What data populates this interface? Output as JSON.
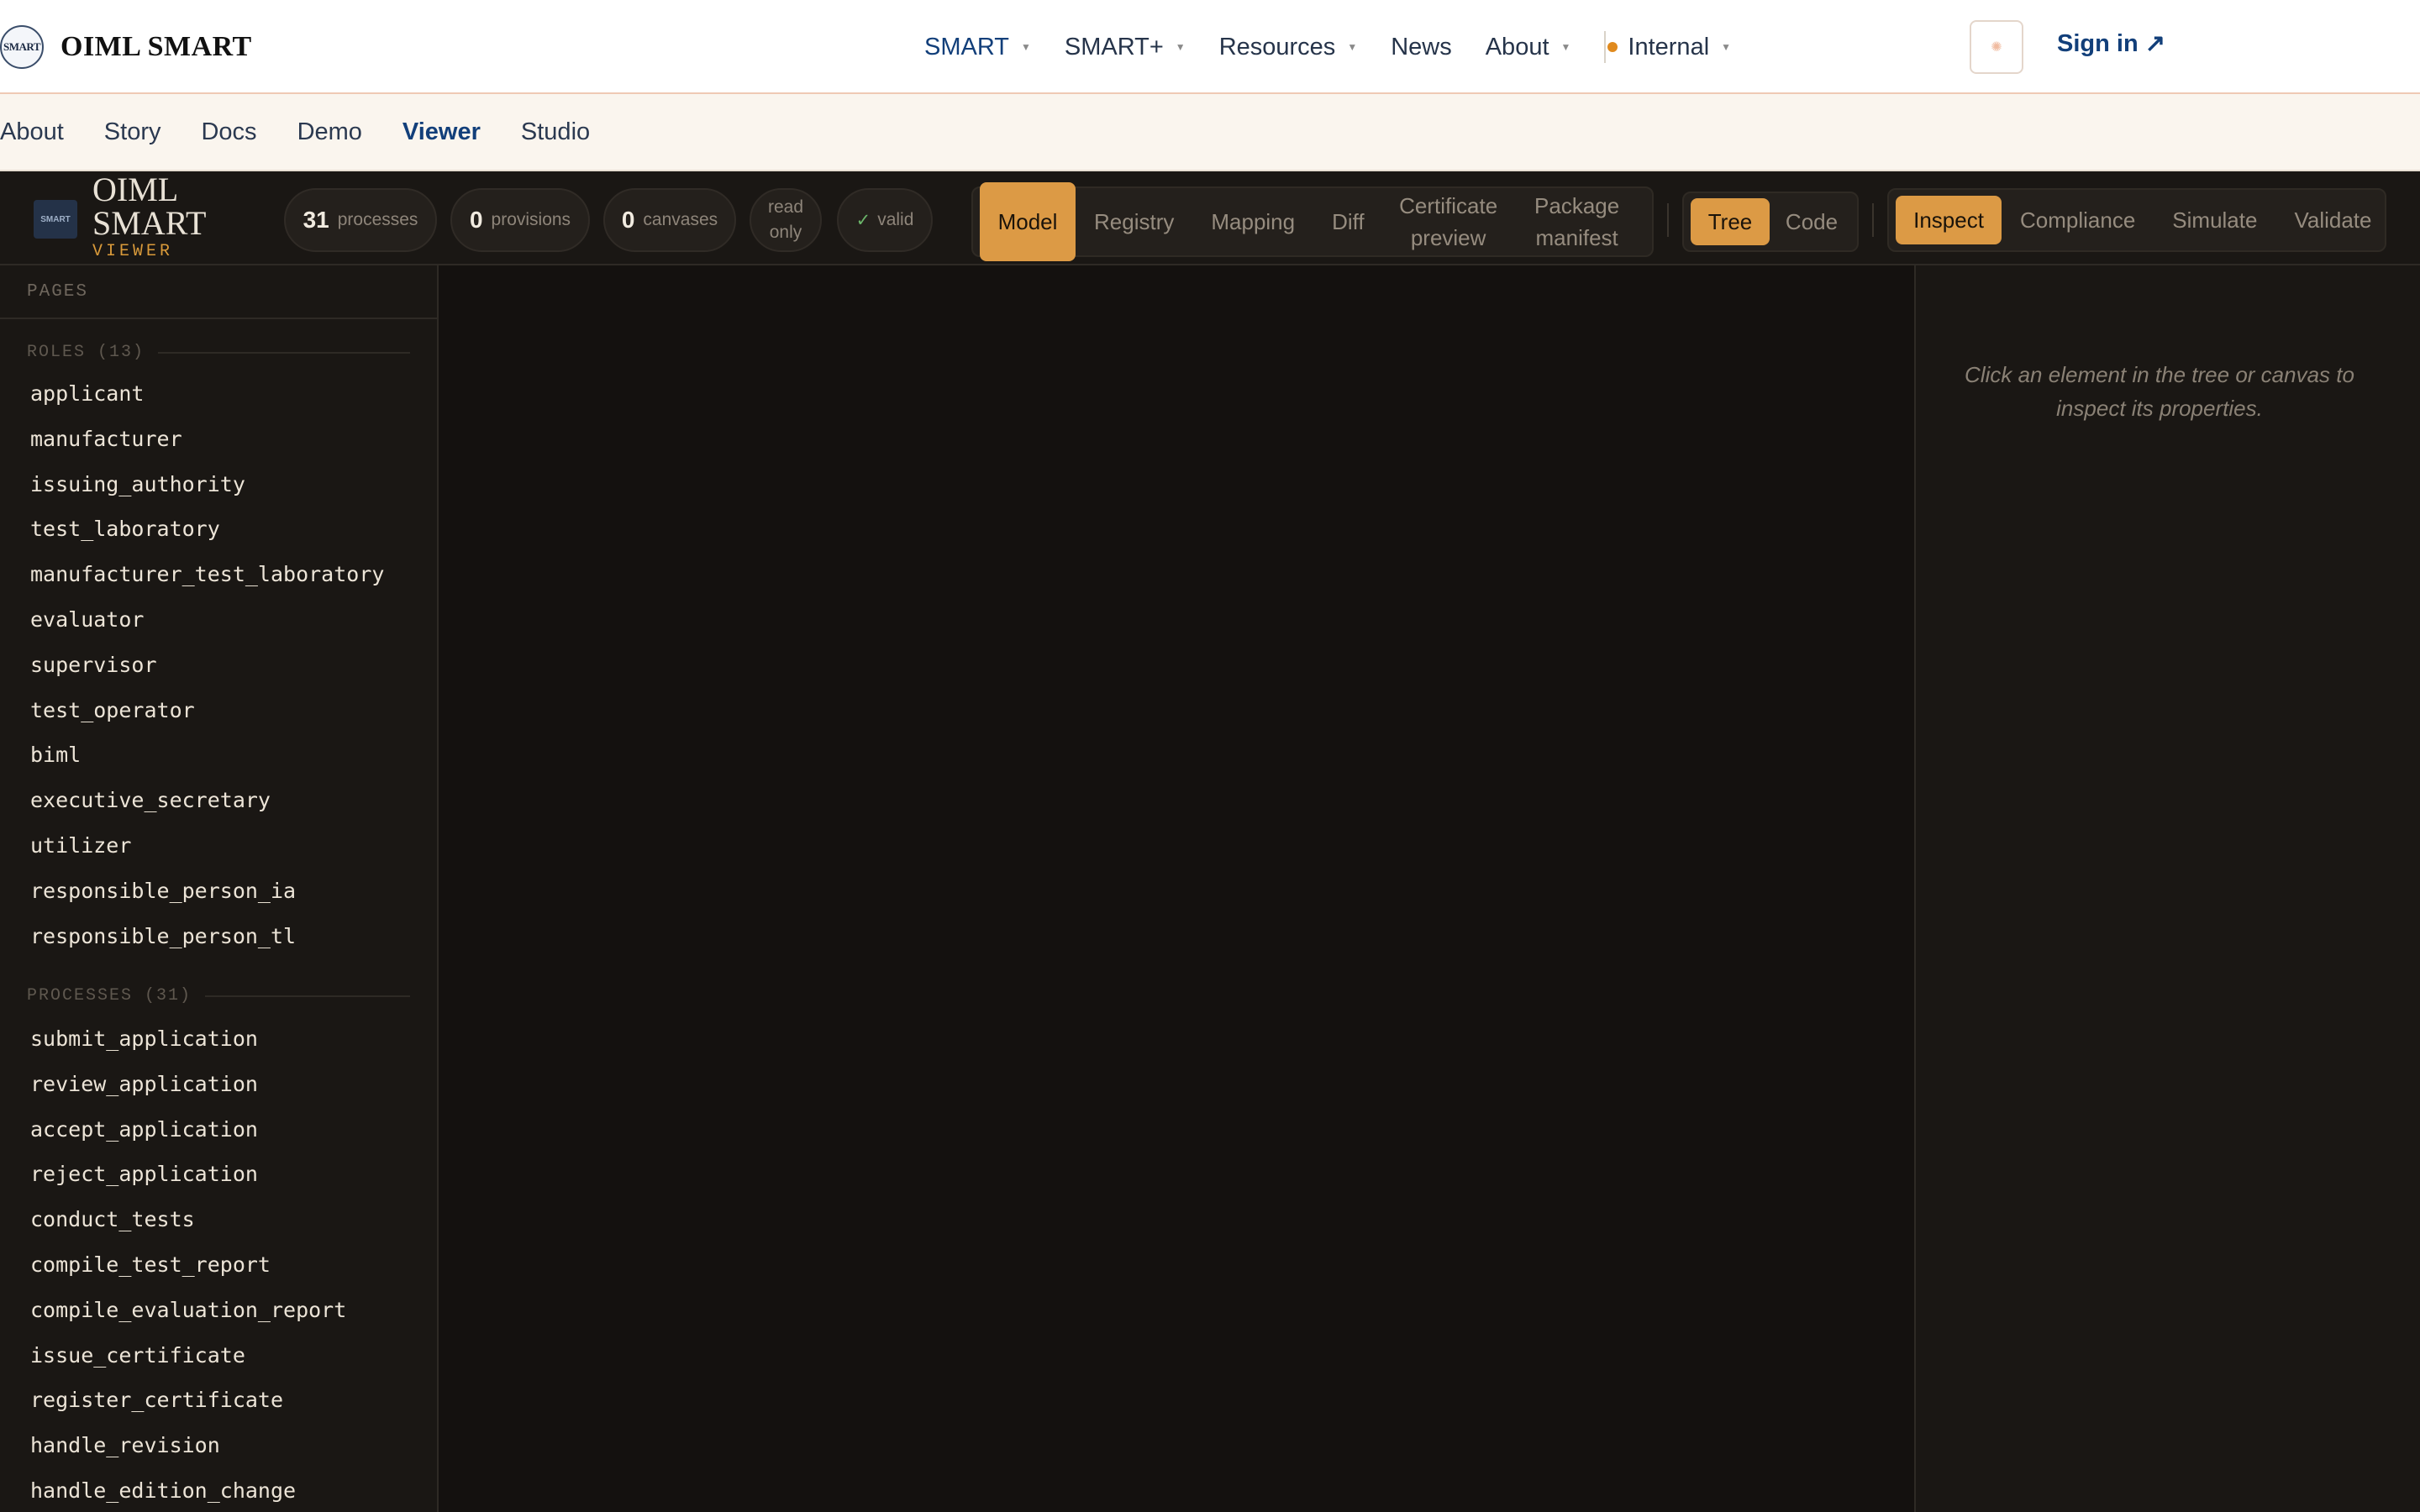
{
  "topnav": {
    "logo_text": "SMART",
    "brand": "OIML SMART",
    "menu": [
      {
        "label": "SMART",
        "caret": true,
        "active": true
      },
      {
        "label": "SMART+",
        "caret": true
      },
      {
        "label": "Resources",
        "caret": true
      },
      {
        "label": "News",
        "caret": false
      },
      {
        "label": "About",
        "caret": true
      },
      {
        "label": "Internal",
        "caret": true
      }
    ],
    "sign_in": "Sign in ↗"
  },
  "subnav": [
    "About",
    "Story",
    "Docs",
    "Demo",
    "Viewer",
    "Studio"
  ],
  "subnav_active": "Viewer",
  "viewer": {
    "logo_text": "SMART",
    "title_line1": "OIML",
    "title_line2": "SMART",
    "subtitle": "VIEWER",
    "stats": {
      "processes_count": "31",
      "processes_label": "processes",
      "provisions_count": "0",
      "provisions_label": "provisions",
      "canvases_count": "0",
      "canvases_label": "canvases",
      "read_line1": "read",
      "read_line2": "only",
      "valid_label": "valid"
    },
    "view_tabs": [
      "Model",
      "Registry",
      "Mapping",
      "Diff",
      "Certificate preview",
      "Package manifest"
    ],
    "mode_tabs": [
      "Tree",
      "Code"
    ],
    "panel_tabs": [
      "Inspect",
      "Compliance",
      "Simulate",
      "Validate"
    ]
  },
  "sidebar": {
    "pages_label": "PAGES",
    "roles_label": "ROLES (13)",
    "roles": [
      "applicant",
      "manufacturer",
      "issuing_authority",
      "test_laboratory",
      "manufacturer_test_laboratory",
      "evaluator",
      "supervisor",
      "test_operator",
      "biml",
      "executive_secretary",
      "utilizer",
      "responsible_person_ia",
      "responsible_person_tl"
    ],
    "processes_label": "PROCESSES (31)",
    "processes": [
      "submit_application",
      "review_application",
      "accept_application",
      "reject_application",
      "conduct_tests",
      "compile_test_report",
      "compile_evaluation_report",
      "issue_certificate",
      "register_certificate",
      "handle_revision",
      "handle_edition_change"
    ]
  },
  "inspector": {
    "hint": "Click an element in the tree or canvas to inspect its properties."
  },
  "colors": {
    "accent": "#dc9a45",
    "nav_active": "#123f7a",
    "internal_dot": "#e08a1e",
    "valid_check": "#6bb56a"
  }
}
